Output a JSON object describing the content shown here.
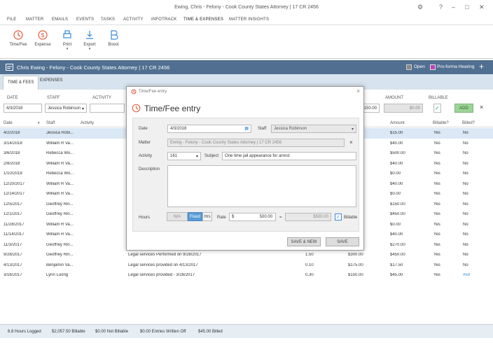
{
  "window": {
    "title": "Ewing, Chris - Felony - Cook County States Attorney | 17 CR 2456",
    "help": "?"
  },
  "menu": [
    "FILE",
    "MATTER",
    "EMAILS",
    "EVENTS",
    "TASKS",
    "ACTIVITY",
    "INFOTRACK",
    "TIME & EXPENSES",
    "MATTER INSIGHTS"
  ],
  "ribbon": {
    "time_fee": "Time/Fee",
    "expense": "Expense",
    "print": "Print",
    "export": "Export",
    "boost": "Boost"
  },
  "matter_bar": {
    "title": "Chris Ewing - Felony - Cook County States Attorney | 17 CR 2456",
    "open_label": "Open",
    "proforma_label": "Pro-forma Hearing",
    "plus": "+"
  },
  "subtabs": {
    "time_fees": "TIME & FEES",
    "expenses": "EXPENSES"
  },
  "filter": {
    "date_label": "DATE",
    "date_value": "4/3/2018",
    "staff_label": "STAFF",
    "staff_value": "Jessica Robinson",
    "activity_label": "ACTIVITY",
    "rate_value": "150.00",
    "amount_label": "AMOUNT",
    "amount_value": "$0.00",
    "billable_label": "BILLABLE",
    "billable_check": "✓",
    "add_label": "ADD",
    "close": "×"
  },
  "grid": {
    "headers": {
      "date": "Date",
      "staff": "Staff",
      "activity": "Activity",
      "amount": "Amount",
      "billable": "Billable?",
      "billed": "Billed?"
    },
    "rows": [
      {
        "date": "4/2/2018",
        "staff": "Jessica Robi...",
        "subject": "",
        "hours": "",
        "rate": "",
        "amount": "$15.00",
        "billable": "Yes",
        "billed": "No"
      },
      {
        "date": "3/14/2018",
        "staff": "William R Va...",
        "subject": "",
        "hours": "",
        "rate": "",
        "amount": "$40.00",
        "billable": "Yes",
        "billed": "No"
      },
      {
        "date": "3/6/2018",
        "staff": "Rebecca Wo...",
        "subject": "",
        "hours": "",
        "rate": "",
        "amount": "$500.00",
        "billable": "Yes",
        "billed": "No"
      },
      {
        "date": "2/8/2018",
        "staff": "William R Va...",
        "subject": "",
        "hours": "",
        "rate": "",
        "amount": "$40.00",
        "billable": "Yes",
        "billed": "No"
      },
      {
        "date": "1/10/2018",
        "staff": "Rebecca Wo...",
        "subject": "",
        "hours": "",
        "rate": "",
        "amount": "$0.00",
        "billable": "Yes",
        "billed": "No"
      },
      {
        "date": "12/20/2017",
        "staff": "William R Va...",
        "subject": "",
        "hours": "",
        "rate": "",
        "amount": "$40.00",
        "billable": "Yes",
        "billed": "No"
      },
      {
        "date": "12/14/2017",
        "staff": "William R Va...",
        "subject": "",
        "hours": "",
        "rate": "",
        "amount": "$0.00",
        "billable": "Yes",
        "billed": "No"
      },
      {
        "date": "12/5/2017",
        "staff": "Geoffrey Rin...",
        "subject": "",
        "hours": "",
        "rate": "",
        "amount": "$150.00",
        "billable": "Yes",
        "billed": "No"
      },
      {
        "date": "12/1/2017",
        "staff": "Geoffrey Rin...",
        "subject": "",
        "hours": "",
        "rate": "",
        "amount": "$450.00",
        "billable": "Yes",
        "billed": "No"
      },
      {
        "date": "11/28/2017",
        "staff": "William R Va...",
        "subject": "",
        "hours": "",
        "rate": "",
        "amount": "$0.00",
        "billable": "Yes",
        "billed": "No"
      },
      {
        "date": "11/14/2017",
        "staff": "William R Va...",
        "subject": "",
        "hours": "",
        "rate": "",
        "amount": "$40.00",
        "billable": "Yes",
        "billed": "No"
      },
      {
        "date": "11/3/2017",
        "staff": "Geoffrey Rin...",
        "subject": "",
        "hours": "",
        "rate": "",
        "amount": "$270.00",
        "billable": "Yes",
        "billed": "No"
      },
      {
        "date": "9/28/2017",
        "staff": "Geoffrey Rin...",
        "subject": "Legal services Performed on 9/28/2017",
        "hours": "1.50",
        "rate": "$300.00",
        "amount": "$450.00",
        "billable": "Yes",
        "billed": "No"
      },
      {
        "date": "4/13/2017",
        "staff": "Benjamin Va...",
        "subject": "Legal services provided on 4/13/2017",
        "hours": "0.10",
        "rate": "$175.00",
        "amount": "$17.50",
        "billable": "Yes",
        "billed": "No"
      },
      {
        "date": "3/16/2017",
        "staff": "Lynn Luong",
        "subject": "Legal services provided - 3/16/2017",
        "hours": "0.30",
        "rate": "$150.00",
        "amount": "$45.00",
        "billable": "Yes",
        "billed": "#59"
      }
    ]
  },
  "footer": {
    "hours": "6.8 Hours Logged",
    "billable": "$2,057.50 Billable",
    "not_billable": "$0.00 Not Billable",
    "written_off": "$0.00 Entries Written Off",
    "billed": "$45.00 Billed"
  },
  "dialog": {
    "window_title": "Time/Fee entry",
    "heading": "Time/Fee entry",
    "close": "×",
    "date_label": "Date",
    "date_value": "4/3/2018",
    "staff_label": "Staff",
    "staff_value": "Jessica Robinson",
    "matter_label": "Matter",
    "matter_value": "Ewing - Felony - Cook County States Attorney | 17 CR 2456",
    "matter_clear": "×",
    "activity_label": "Activity",
    "activity_value": "161",
    "subject_label": "Subject",
    "subject_value": "One time jail appearance for arrest",
    "description_label": "Description",
    "hours_label": "Hours",
    "seg_na": "N/A",
    "seg_fixed": "Fixed",
    "seg_hrs": "Hrs",
    "rate_label": "Rate",
    "rate_currency": "$",
    "rate_value": "500.00",
    "rate_eq": "=",
    "total_value": "$500.00",
    "billable_label": "Billable",
    "billable_check": "✓",
    "save_new": "SAVE & NEW",
    "save": "SAVE"
  },
  "colors": {
    "accent": "#506f91",
    "add_green": "#9ed49a",
    "icon_red": "#e05a3a",
    "icon_blue": "#3a8ad8",
    "selected_row": "#dbe8f5"
  }
}
